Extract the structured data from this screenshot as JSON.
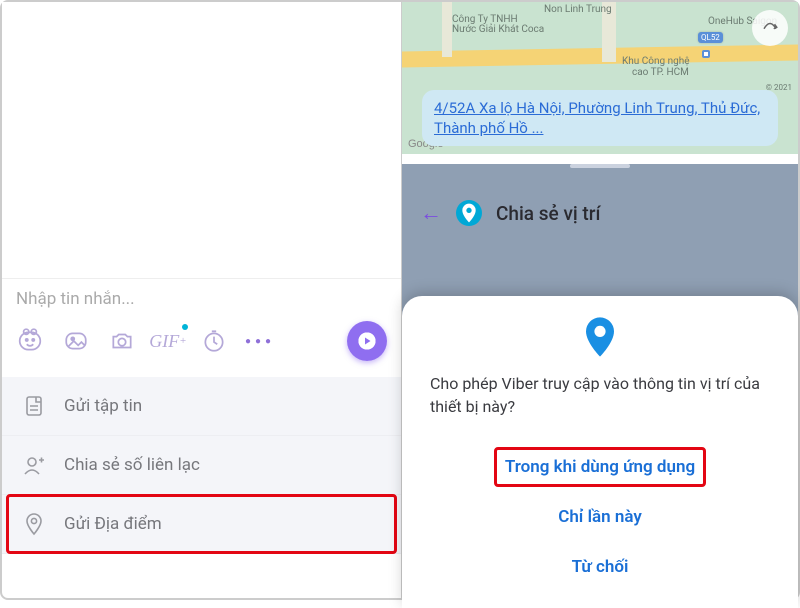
{
  "left": {
    "input_placeholder": "Nhập tin nhắn...",
    "gif_label": "GIF",
    "options": [
      {
        "label": "Gửi tập tin"
      },
      {
        "label": "Chia sẻ số liên lạc"
      },
      {
        "label": "Gửi Địa điểm"
      }
    ]
  },
  "right": {
    "map": {
      "labels": [
        "Non Linh Trung",
        "Công Ty TNHH",
        "Nước Giải Khát Coca",
        "OneHub Saigon",
        "Khu Công nghệ",
        "cao TP. HCM",
        "© 2021"
      ],
      "road_badge": "QL52",
      "google": "Google",
      "address": "4/52A Xa lộ Hà Nội, Phường Linh Trung, Thủ Đức, Thành phố Hồ ..."
    },
    "share_title": "Chia sẻ vị trí",
    "dialog": {
      "message": "Cho phép Viber truy cập vào thông tin vị trí của thiết bị này?",
      "opt_while": "Trong khi dùng ứng dụng",
      "opt_once": "Chỉ lần này",
      "opt_deny": "Từ chối"
    }
  }
}
